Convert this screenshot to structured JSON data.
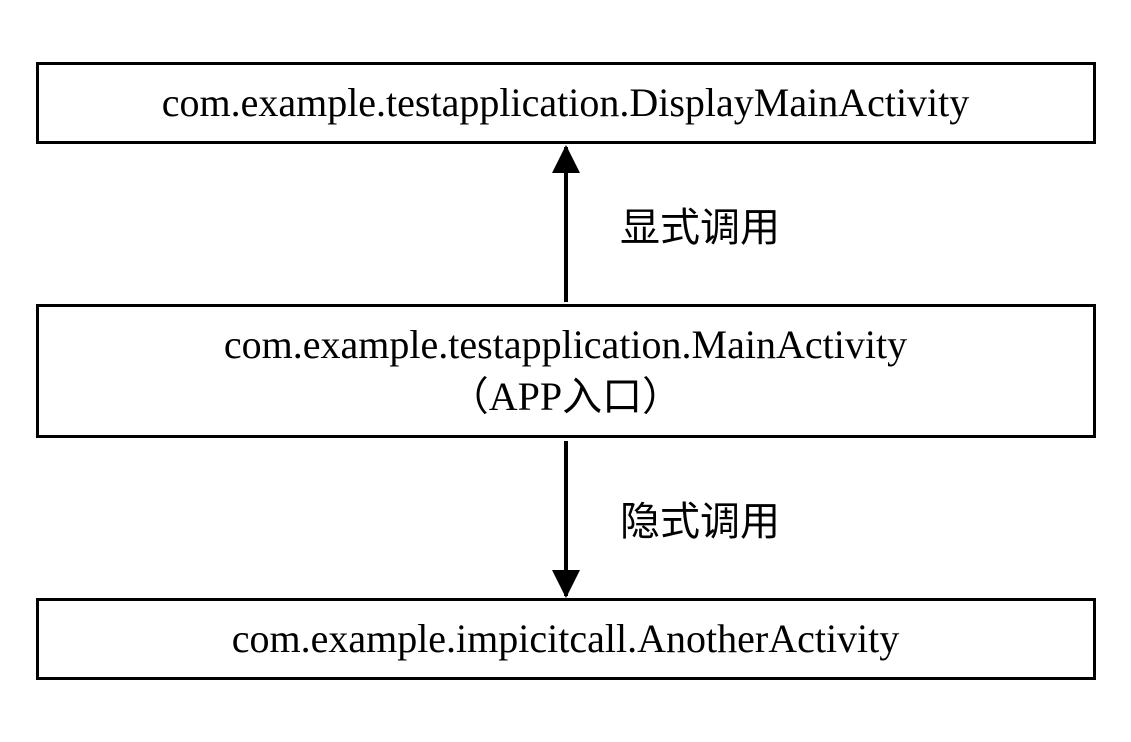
{
  "nodes": {
    "top": {
      "text": "com.example.testapplication.DisplayMainActivity"
    },
    "middle": {
      "line1": "com.example.testapplication.MainActivity",
      "line2": "（APP入口）"
    },
    "bottom": {
      "text": "com.example.impicitcall.AnotherActivity"
    }
  },
  "edges": {
    "top": {
      "label": "显式调用"
    },
    "bottom": {
      "label": "隐式调用"
    }
  }
}
